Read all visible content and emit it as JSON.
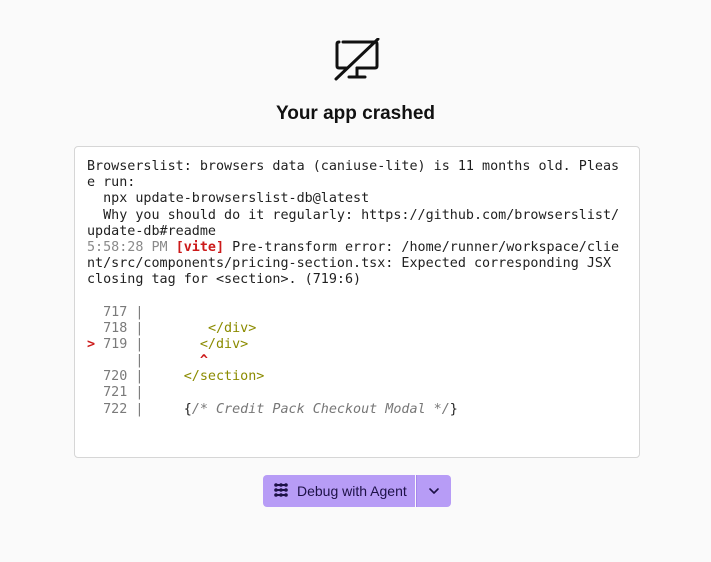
{
  "title": "Your app crashed",
  "log": {
    "lines": [
      "Browserslist: browsers data (caniuse-lite) is 11 months old. Pleas",
      "e run:",
      "  npx update-browserslist-db@latest",
      "  Why you should do it regularly: https://github.com/browserslist/",
      "update-db#readme"
    ],
    "error": {
      "timestamp": "5:58:28 PM",
      "tag": "[vite]",
      "msg_first": " Pre-transform error: /home/runner/workspace/clie",
      "msg_rest": [
        "nt/src/components/pricing-section.tsx: Expected corresponding JSX",
        "closing tag for <section>. (719:6)"
      ]
    },
    "code_frame": {
      "l717": "717",
      "l718": "718",
      "l718_code": "</div>",
      "marker": ">",
      "l719": "719",
      "l719_code": "</div>",
      "caret": "^",
      "l720": "720",
      "l720_code": "</section>",
      "l721": "721",
      "l722": "722",
      "l722_open": "{",
      "l722_comment": "/* Credit Pack Checkout Modal */",
      "l722_close": "}"
    }
  },
  "button": {
    "label": "Debug with Agent",
    "icon": "agent-icon",
    "dropdown_icon": "chevron-down-icon",
    "color": "#b79cf6"
  }
}
